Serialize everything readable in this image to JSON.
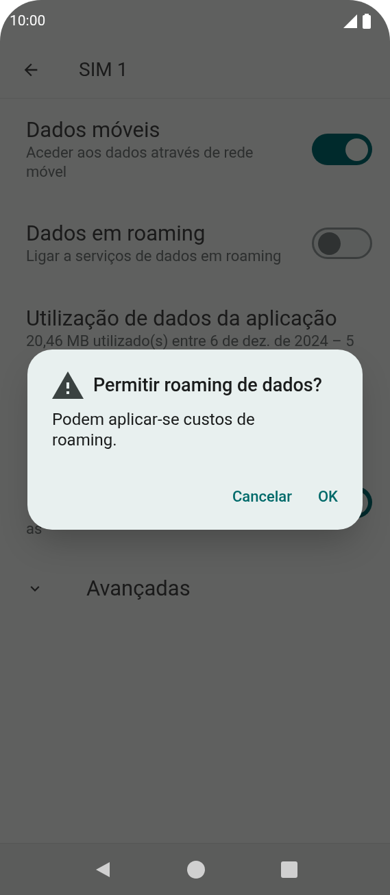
{
  "status_bar": {
    "time": "10:00"
  },
  "toolbar": {
    "title": "SIM 1"
  },
  "settings": [
    {
      "kind": "toggle",
      "title": "Dados móveis",
      "subtitle": "Aceder aos dados através de rede móvel",
      "on": true
    },
    {
      "kind": "toggle",
      "title": "Dados em roaming",
      "subtitle": "Ligar a serviços de dados em roaming",
      "on": false
    },
    {
      "kind": "text",
      "title": "Utilização de dados da aplicação",
      "subtitle": "20,46 MB utilizado(s) entre 6 de dez. de 2024 – 5"
    },
    {
      "kind": "toggle",
      "subtitle": "as",
      "on": true
    },
    {
      "kind": "expander",
      "title": "Avançadas",
      "expanded": false
    }
  ],
  "dialog": {
    "title": "Permitir roaming de dados?",
    "message": "Podem aplicar-se custos de roaming.",
    "buttons": [
      "Cancelar",
      "OK"
    ]
  }
}
